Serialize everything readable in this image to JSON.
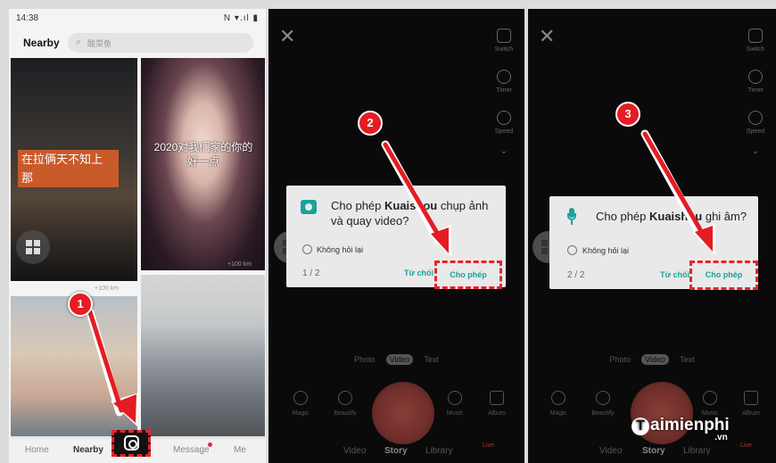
{
  "left": {
    "status_time": "14:38",
    "status_right": "N ▾.ıl ▮",
    "header_title": "Nearby",
    "search_placeholder": "酸菜鱼",
    "card1_caption": "在拉俩天不知上\n那",
    "card2_caption": "2020对我们家的你的\n好一点",
    "card2_distance": "+100 km",
    "card1_distance": "+100 km",
    "nav": [
      "Home",
      "Nearby",
      "Message",
      "Me"
    ],
    "step": "1"
  },
  "middle": {
    "side": [
      "Switch",
      "Timer",
      "Speed"
    ],
    "dialog_title_a": "Cho phép ",
    "dialog_app": "Kuaishou",
    "dialog_title_b": " chụp ảnh và quay video?",
    "dont_ask": "Không hỏi lại",
    "page": "1 / 2",
    "deny": "Từ chối",
    "allow": "Cho phép",
    "modes": [
      "Photo",
      "Video",
      "Text"
    ],
    "tools": [
      "Magic",
      "Beautify",
      "Music",
      "Album"
    ],
    "bottom": [
      "Video",
      "Story",
      "Library",
      "Live"
    ],
    "step": "2"
  },
  "right": {
    "side": [
      "Switch",
      "Timer",
      "Speed"
    ],
    "dialog_title_a": "Cho phép ",
    "dialog_app": "Kuaishou",
    "dialog_title_b": " ghi âm?",
    "dont_ask": "Không hỏi lại",
    "page": "2 / 2",
    "deny": "Từ chối",
    "allow": "Cho phép",
    "modes": [
      "Photo",
      "Video",
      "Text"
    ],
    "tools": [
      "Magic",
      "Beautify",
      "Music",
      "Album"
    ],
    "bottom": [
      "Video",
      "Story",
      "Library",
      "Live"
    ],
    "step": "3"
  },
  "watermark": {
    "brand": "aimienphi",
    "suffix": ".vn"
  },
  "colors": {
    "highlight": "#e8232b",
    "teal": "#1aa29d",
    "badge": "#e51c23"
  }
}
